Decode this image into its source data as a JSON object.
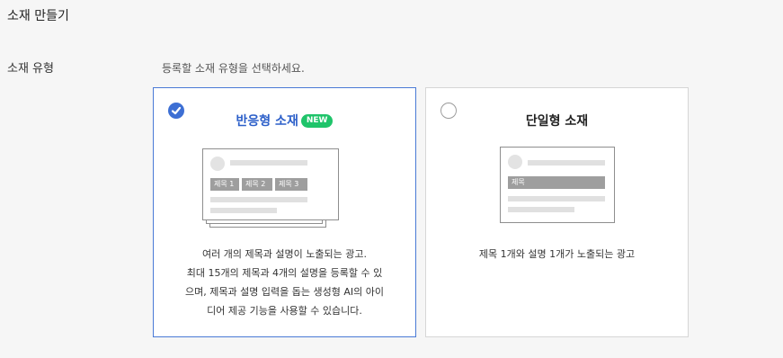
{
  "page": {
    "title": "소재 만들기"
  },
  "form": {
    "type_label": "소재 유형",
    "instruction": "등록할 소재 유형을 선택하세요."
  },
  "options": [
    {
      "title": "반응형 소재",
      "badge": "NEW",
      "selected": true,
      "mock_tags": [
        "제목 1",
        "제목 2",
        "제목 3"
      ],
      "description": [
        "여러 개의 제목과 설명이 노출되는 광고.",
        "최대 15개의 제목과 4개의 설명을 등록할 수 있",
        "으며, 제목과 설명 입력을 돕는 생성형 AI의 아이",
        "디어 제공 기능을 사용할 수 있습니다."
      ]
    },
    {
      "title": "단일형 소재",
      "selected": false,
      "mock_tags": [
        "제목"
      ],
      "description": [
        "제목 1개와 설명 1개가 노출되는 광고"
      ]
    }
  ],
  "colors": {
    "accent": "#3d6fd4",
    "selected_border": "#4a7ad6",
    "badge": "#1fc46a"
  },
  "icons": {
    "selected_radio": "check-circle-icon",
    "unselected_radio": "empty-radio-icon"
  }
}
